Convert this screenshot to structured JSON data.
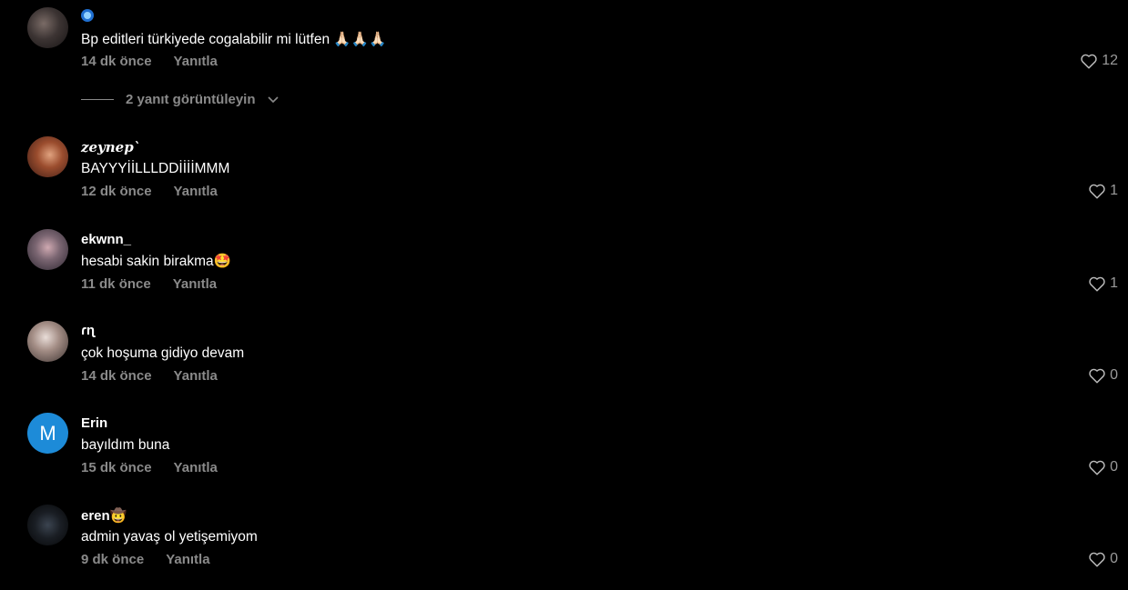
{
  "comments": [
    {
      "username": "",
      "verified": true,
      "text": "Bp editleri türkiyede cogalabilir mi lütfen 🙏🏻🙏🏻🙏🏻",
      "time": "14 dk önce",
      "reply": "Yanıtla",
      "likes": "12"
    },
    {
      "username": "𝒛𝒆𝒚𝒏𝒆𝒑`",
      "text": "BAYYYİİLLLDDİİİİMMM",
      "time": "12 dk önce",
      "reply": "Yanıtla",
      "likes": "1"
    },
    {
      "username": "ekwnn_",
      "text": "hesabi sakin birakma🤩",
      "time": "11 dk önce",
      "reply": "Yanıtla",
      "likes": "1"
    },
    {
      "username": "ɾɳ",
      "text": "çok hoşuma gidiyo devam",
      "time": "14 dk önce",
      "reply": "Yanıtla",
      "likes": "0"
    },
    {
      "username": "Erin",
      "avatar_letter": "M",
      "text": "bayıldım buna",
      "time": "15 dk önce",
      "reply": "Yanıtla",
      "likes": "0"
    },
    {
      "username": "eren🤠",
      "text": "admin yavaş ol yetişemiyom",
      "time": "9 dk önce",
      "reply": "Yanıtla",
      "likes": "0"
    }
  ],
  "view_replies": "2 yanıt görüntüleyin",
  "colors": {
    "background": "#000000",
    "muted_text": "#8a8a8a",
    "avatar_letter_bg": "#1d8bd8",
    "verified_badge": "#4aa8ff"
  },
  "icons": {
    "like": "heart-outline-icon",
    "expand": "chevron-down-icon",
    "verified": "verified-badge-icon"
  }
}
